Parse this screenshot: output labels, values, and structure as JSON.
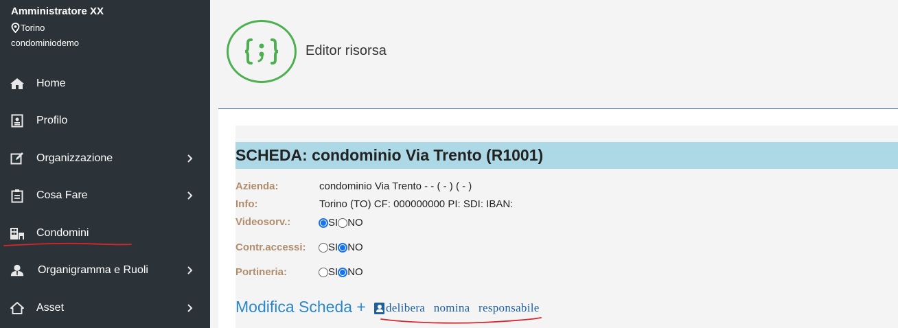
{
  "user": {
    "name": "Amministratore XX",
    "city": "Torino",
    "org": "condominiodemo"
  },
  "sidebar": {
    "items": [
      {
        "label": "Home",
        "icon": "home-icon",
        "has_chevron": false
      },
      {
        "label": "Profilo",
        "icon": "profile-icon",
        "has_chevron": false
      },
      {
        "label": "Organizzazione",
        "icon": "edit-icon",
        "has_chevron": true
      },
      {
        "label": "Cosa Fare",
        "icon": "clipboard-icon",
        "has_chevron": true
      },
      {
        "label": "Condomini",
        "icon": "building-icon",
        "has_chevron": false
      },
      {
        "label": "Organigramma e Ruoli",
        "icon": "user-tie-icon",
        "has_chevron": true
      },
      {
        "label": "Asset",
        "icon": "house-outline-icon",
        "has_chevron": true
      }
    ]
  },
  "header": {
    "title": "Editor risorsa",
    "logo_icon": "code-braces-icon"
  },
  "scheda": {
    "title": "SCHEDA: condominio Via Trento (R1001)",
    "fields": {
      "azienda_label": "Azienda:",
      "azienda_value": "condominio Via Trento - - ( - ) ( - )",
      "info_label": "Info:",
      "info_value": "Torino (TO) CF: 000000000 PI: SDI: IBAN:",
      "videosorv_label": "Videosorv.:",
      "contr_label": "Contr.accessi:",
      "portineria_label": "Portineria:"
    },
    "radio_si": "SI",
    "radio_no": "NO",
    "videosorv_selected": "SI",
    "contr_selected": "NO",
    "portineria_selected": "NO"
  },
  "actions": {
    "modifica_label": "Modifica Scheda +",
    "delibera_label": "delibera nomina responsabile"
  },
  "colors": {
    "sidebar_bg": "#2b3338",
    "accent_green": "#4caf50",
    "scheda_bar": "#add8e6",
    "label_brown": "#b08d6d",
    "link_blue": "#2a87c8",
    "annotation_red": "#d9262c"
  }
}
